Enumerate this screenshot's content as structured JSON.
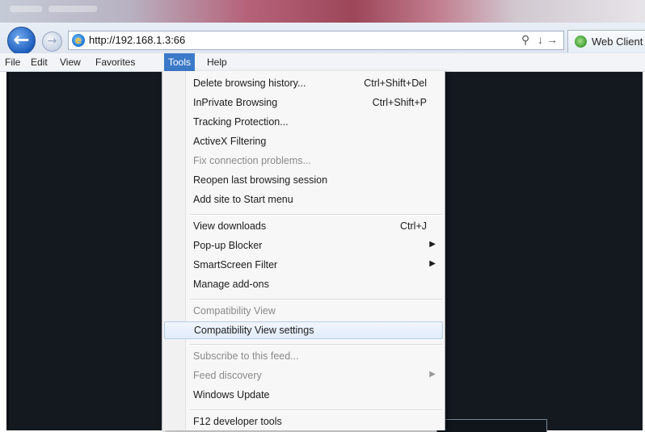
{
  "browser": {
    "url": "http://192.168.1.3:66",
    "search_arrow": "↓ →",
    "tab_title": "Web Client"
  },
  "menubar": {
    "items": [
      "File",
      "Edit",
      "View",
      "Favorites",
      "Tools",
      "Help"
    ],
    "active": "Tools"
  },
  "tools_menu": {
    "items": [
      {
        "label": "Delete browsing history...",
        "shortcut": "Ctrl+Shift+Del"
      },
      {
        "label": "InPrivate Browsing",
        "shortcut": "Ctrl+Shift+P"
      },
      {
        "label": "Tracking Protection..."
      },
      {
        "label": "ActiveX Filtering"
      },
      {
        "label": "Fix connection problems...",
        "disabled": true
      },
      {
        "label": "Reopen last browsing session"
      },
      {
        "label": "Add site to Start menu"
      },
      {
        "label": "View downloads",
        "shortcut": "Ctrl+J"
      },
      {
        "label": "Pop-up Blocker",
        "submenu": true
      },
      {
        "label": "SmartScreen Filter",
        "submenu": true
      },
      {
        "label": "Manage add-ons"
      },
      {
        "label": "Compatibility View",
        "disabled": true
      },
      {
        "label": "Compatibility View settings",
        "highlighted": true
      },
      {
        "label": "Subscribe to this feed...",
        "disabled": true
      },
      {
        "label": "Feed discovery",
        "disabled": true,
        "submenu": true
      },
      {
        "label": "Windows Update"
      },
      {
        "label": "F12 developer tools"
      }
    ]
  },
  "icons": {
    "back": "back-arrow-icon",
    "forward": "forward-arrow-icon",
    "page": "ie-page-icon",
    "search": "search-icon",
    "tab": "ie-tab-icon",
    "submenu": "submenu-arrow-icon"
  },
  "colors": {
    "menu_highlight": "#3b79c9",
    "content_bg": "#141920",
    "hover_bg": "#e1ecfa"
  }
}
